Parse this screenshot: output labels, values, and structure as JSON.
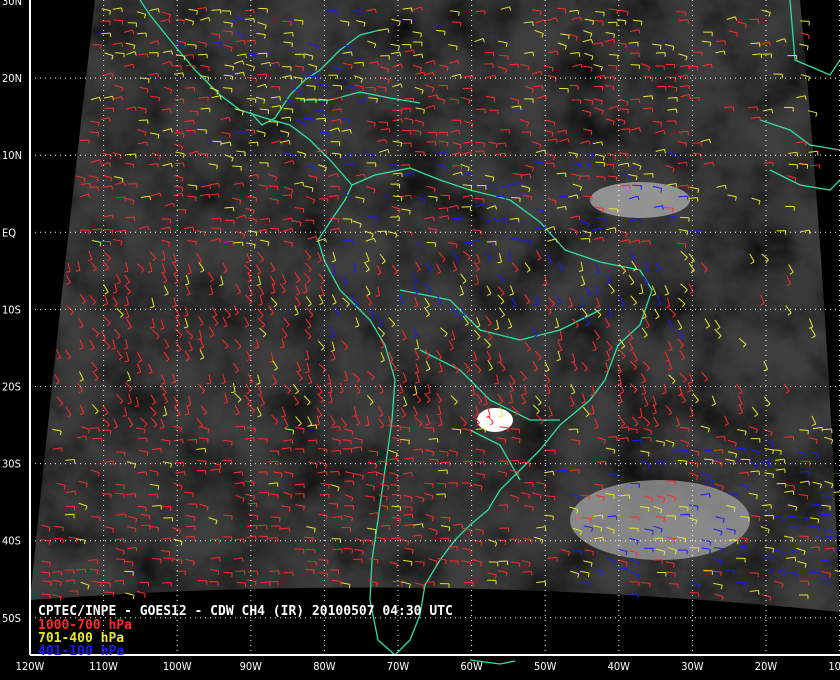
{
  "title": "CPTEC/INPE - GOES12 - CDW CH4 (IR) 20100507 04:30 UTC",
  "legend": [
    {
      "label": "1000-700 hPa",
      "color": "#ff2a2a"
    },
    {
      "label": "701-400 hPa",
      "color": "#e6e62a"
    },
    {
      "label": "401-100 hPa",
      "color": "#1a1aff"
    }
  ],
  "lat_labels": [
    "30N",
    "20N",
    "10N",
    "EQ",
    "10S",
    "20S",
    "30S",
    "40S",
    "50S"
  ],
  "lon_labels": [
    "120W",
    "110W",
    "100W",
    "90W",
    "80W",
    "70W",
    "60W",
    "50W",
    "40W",
    "30W",
    "20W",
    "10W"
  ],
  "colors": {
    "coast": "#2ee0a0",
    "grid": "#ffffff",
    "background": "#000000"
  }
}
